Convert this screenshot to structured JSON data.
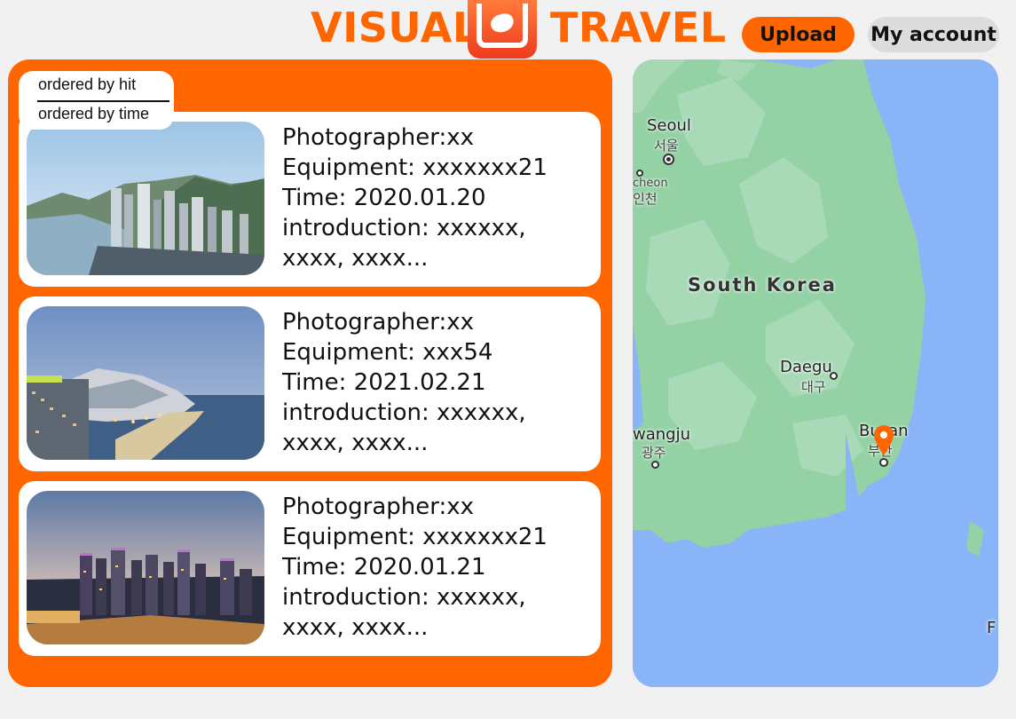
{
  "header": {
    "brand_left": "VISUAL",
    "brand_right": "TRAVEL",
    "logo_icon": "camera-logo-icon",
    "upload_label": "Upload",
    "account_label": "My account",
    "accent_color": "#ff6600"
  },
  "sort": {
    "options": [
      "ordered by hit",
      "ordered by time"
    ]
  },
  "cards": [
    {
      "photographer": "Photographer:xx",
      "equipment": "Equipment: xxxxxxx21",
      "time": "Time: 2020.01.20",
      "introduction": "introduction: xxxxxx, xxxx, xxxx..."
    },
    {
      "photographer": "Photographer:xx",
      "equipment": "Equipment: xxx54",
      "time": "Time: 2021.02.21",
      "introduction": "introduction: xxxxxx, xxxx, xxxx..."
    },
    {
      "photographer": "Photographer:xx",
      "equipment": "Equipment: xxxxxxx21",
      "time": "Time: 2020.01.21",
      "introduction": "introduction: xxxxxx, xxxx, xxxx..."
    }
  ],
  "map": {
    "country": "South Korea",
    "cities": [
      {
        "en": "Seoul",
        "ko": "서울"
      },
      {
        "en": "cheon",
        "ko": "인천"
      },
      {
        "en": "Daegu",
        "ko": "대구"
      },
      {
        "en": "wangju",
        "ko": "광주"
      },
      {
        "en": "Busan",
        "ko": "부산"
      }
    ],
    "edge_label": "F",
    "pin_icon": "map-pin-icon",
    "pin_color": "#ff6600"
  }
}
